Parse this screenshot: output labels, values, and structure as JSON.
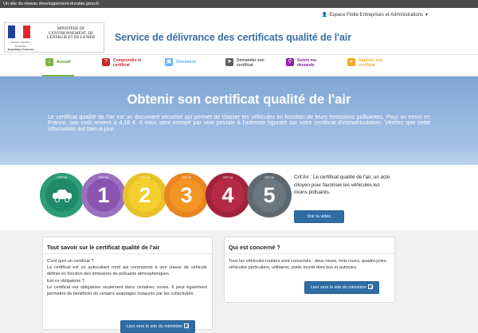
{
  "topbar": {
    "text": "Un site du réseau developpement-durable.gouv.fr"
  },
  "header": {
    "espace_label": "Espace Flotte Entreprises et Administrations",
    "ministry": "Ministère de l'Environnement, de l'Énergie et de la Mer",
    "motto": "Liberté • Égalité • Fraternité",
    "republique": "République Française",
    "site_title": "Service de délivrance des certificats qualité de l'air"
  },
  "nav": {
    "items": [
      {
        "label": "Accueil",
        "icon": "home-icon",
        "color": "#7cb342",
        "active": true
      },
      {
        "label": "Comprendre le certificat",
        "icon": "question-icon",
        "color": "#c62828"
      },
      {
        "label": "Simulation",
        "icon": "car-icon",
        "color": "#64b5f6"
      },
      {
        "label": "Demander son certificat",
        "icon": "send-icon",
        "color": "#616161"
      },
      {
        "label": "Suivre ma demande",
        "icon": "search-icon",
        "color": "#8e24aa"
      },
      {
        "label": "Apposer son certificat",
        "icon": "sticker-icon",
        "color": "#f9a825"
      }
    ]
  },
  "hero": {
    "title": "Obtenir son certificat qualité de l'air",
    "text": "Le certificat qualité de l'air est un document sécurisé qui permet de classer les véhicules en fonction de leurs émissions polluantes. Pour un envoi en France, son coût revient à 4,18 €. Il vous sera envoyé par voie postale à l'adresse figurant sur votre certificat d'immatriculation. Vérifiez que cette information est bien à jour."
  },
  "stickers": [
    {
      "label": "CRIT'Air",
      "value": "",
      "outer": "#2e9c78",
      "inner": "#1f8a68"
    },
    {
      "label": "CRIT'Air",
      "value": "1",
      "outer": "#9c6fbf",
      "inner": "#8a55b0"
    },
    {
      "label": "CRIT'Air",
      "value": "2",
      "outer": "#e6c22a",
      "inner": "#f2cf2c"
    },
    {
      "label": "CRIT'Air",
      "value": "3",
      "outer": "#e88520",
      "inner": "#f29524"
    },
    {
      "label": "CRIT'Air",
      "value": "4",
      "outer": "#a3223b",
      "inner": "#b52b45"
    },
    {
      "label": "CRIT'Air",
      "value": "5",
      "outer": "#5d6870",
      "inner": "#6b7780"
    }
  ],
  "band": {
    "text": "Crit'Air : Le certificat qualité de l'air, un acte citoyen pour favoriser les véhicules les moins polluants.",
    "video_button": "Voir la vidéo"
  },
  "card1": {
    "title": "Tout savoir sur le certificat qualité de l'air",
    "body": "C'est quoi un certificat ?\nLe certificat est un autocollant rond qui correspond à une classe de véhicule définie en fonction des émissions de polluants atmosphériques.\nEst-ce obligatoire ?\nLe certificat est obligatoire seulement dans certaines zones. Il peut également permettre de bénéficier de certains avantages instaurés par les collectivités.",
    "button": "Lien vers le site du ministère"
  },
  "card2": {
    "title": "Qui est concerné ?",
    "body": "Tous les véhicules routiers sont concernés : deux roues, trois roues, quadricycles, véhicules particuliers, utilitaires, poids lourds dont bus et autocars.",
    "button": "Lien vers le site du ministère"
  }
}
